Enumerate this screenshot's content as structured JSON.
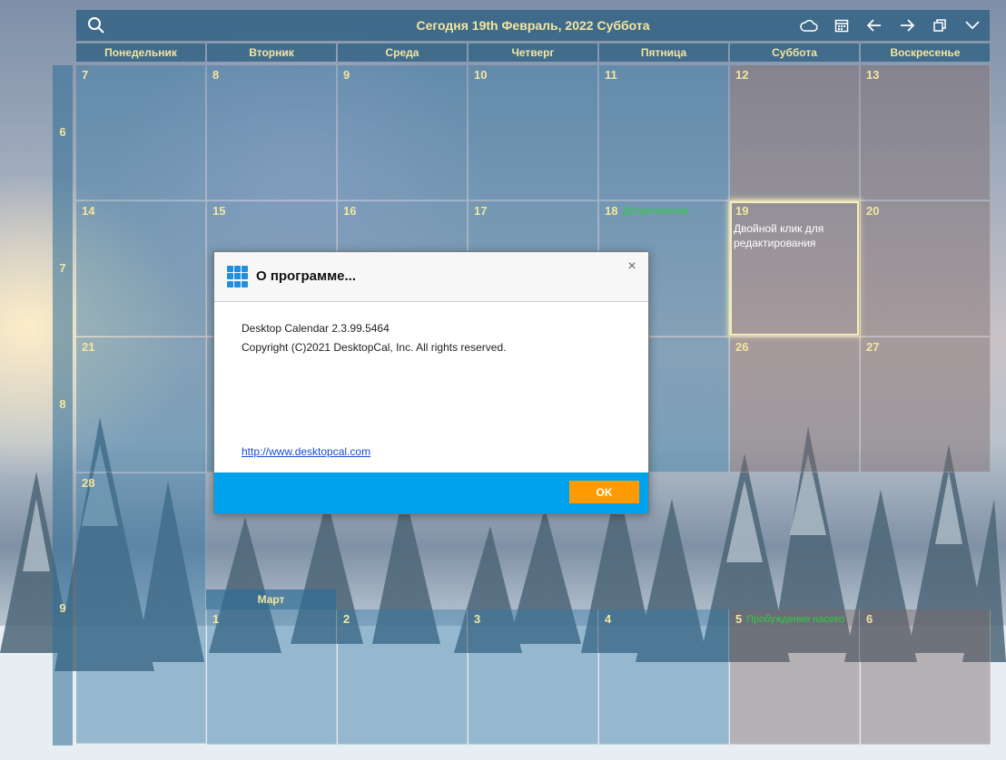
{
  "header": {
    "title": "Сегодня 19th Февраль, 2022 Суббота",
    "icons": [
      "search-icon",
      "cloud-icon",
      "calendar-icon",
      "arrow-left-icon",
      "arrow-right-icon",
      "restore-window-icon",
      "chevron-down-icon"
    ]
  },
  "weekdays": [
    "Понедельник",
    "Вторник",
    "Среда",
    "Четверг",
    "Пятница",
    "Суббота",
    "Воскресенье"
  ],
  "week_numbers": [
    "6",
    "7",
    "8",
    "9"
  ],
  "days": {
    "r0": [
      "7",
      "8",
      "9",
      "10",
      "11",
      "12",
      "13"
    ],
    "r1": [
      "14",
      "15",
      "16",
      "17",
      "18",
      "19",
      "20"
    ],
    "r2": [
      "21",
      "26",
      "27"
    ],
    "r3": [
      "28"
    ],
    "r4": [
      "1",
      "2",
      "3",
      "4",
      "5",
      "6"
    ]
  },
  "events": {
    "d18": "Дотрячеполов",
    "d19_note": "Двойной клик для редактирования",
    "d5": "Пробуждение насеко"
  },
  "month_label": "Март",
  "dialog": {
    "title": "О программе...",
    "version": "Desktop Calendar  2.3.99.5464",
    "copyright": "Copyright (C)2021 DesktopCal, Inc. All rights reserved.",
    "link": "http://www.desktopcal.com",
    "ok": "OK",
    "close": "×"
  },
  "colors": {
    "accent_text": "#f3e6a0",
    "event_green": "#2ecc40",
    "dialog_footer": "#00a2ee",
    "ok_button": "#ff9b00"
  }
}
